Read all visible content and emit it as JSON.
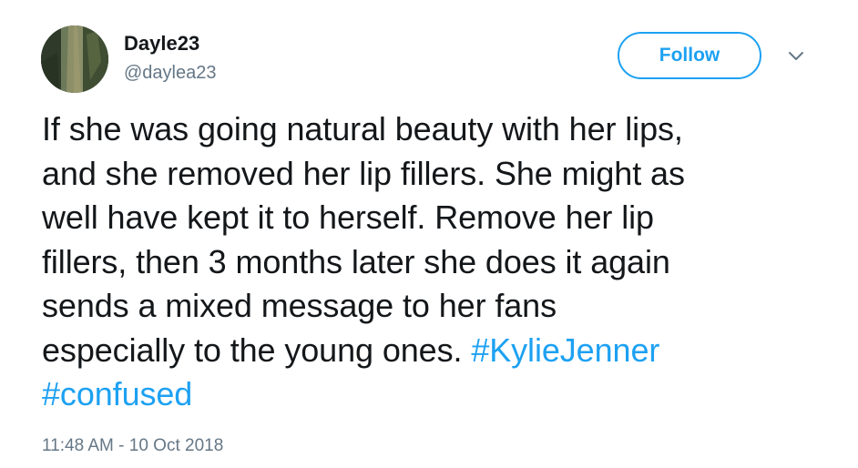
{
  "author": {
    "display_name": "Dayle23",
    "handle": "@daylea23"
  },
  "follow_button": {
    "label": "Follow"
  },
  "tweet": {
    "lines": [
      "If she was going natural beauty with her lips,",
      "and she removed her lip fillers. She might as",
      "well have kept it to herself. Remove her lip",
      "fillers, then 3 months later she does it again",
      "sends a mixed message to her fans",
      "especially to the young ones."
    ],
    "hashtags": [
      "#KylieJenner",
      "#confused"
    ]
  },
  "timestamp": "11:48 AM - 10 Oct 2018",
  "colors": {
    "accent": "#1da1f2",
    "text": "#14171a",
    "secondary_text": "#657786"
  },
  "icons": {
    "avatar": "avatar-photo",
    "menu": "chevron-down-icon"
  }
}
